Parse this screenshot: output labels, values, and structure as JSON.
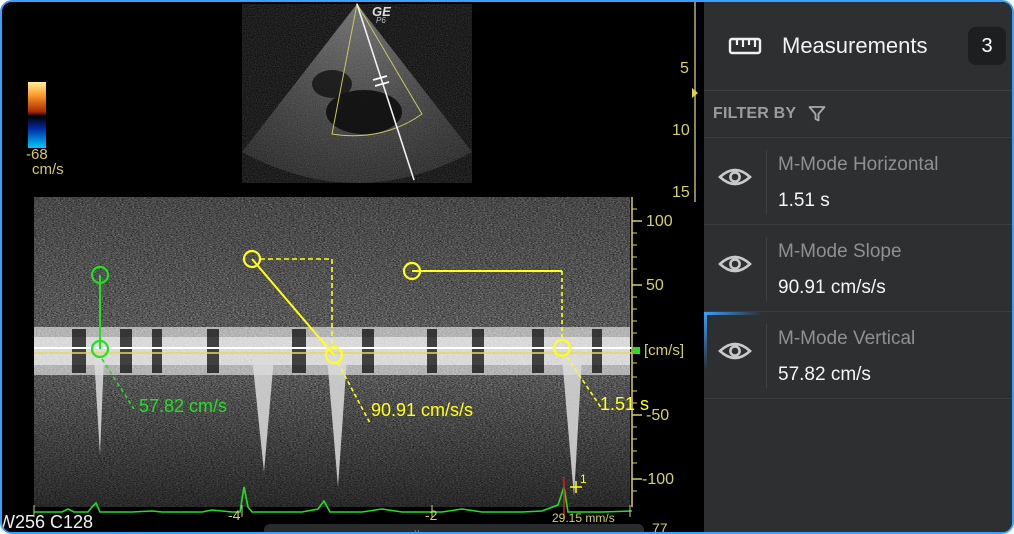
{
  "viewer": {
    "vendor": "GE",
    "probe": "P6",
    "colorbar_value": "-68",
    "colorbar_unit": "cm/s",
    "depth_ticks": [
      "5",
      "10",
      "15"
    ],
    "velocity_ticks": [
      "100",
      "50",
      "-50",
      "-100"
    ],
    "velocity_unit": "[cm/s]",
    "time_ticks": [
      "-4",
      "-2"
    ],
    "sweep_speed": "29.15 mm/s",
    "window_level": "W256 C128",
    "bottom_right_value": "77",
    "cursor_marker": "1",
    "annotations": {
      "vertical": "57.82 cm/s",
      "slope": "90.91 cm/s/s",
      "horizontal": "1.51 s"
    },
    "colors": {
      "green": "#22e022",
      "yellow": "#ffff1a",
      "tick": "#d6cf6a"
    }
  },
  "panel": {
    "title": "Measurements",
    "count": "3",
    "filter_label": "FILTER BY",
    "items": [
      {
        "name": "M-Mode Horizontal",
        "value": "1.51 s"
      },
      {
        "name": "M-Mode Slope",
        "value": "90.91 cm/s/s"
      },
      {
        "name": "M-Mode Vertical",
        "value": "57.82 cm/s"
      }
    ]
  }
}
